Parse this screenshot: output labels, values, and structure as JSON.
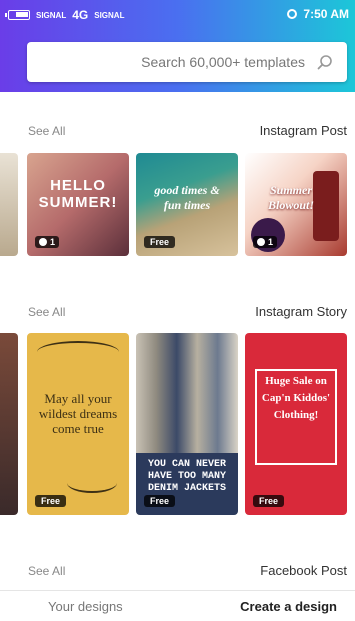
{
  "status_bar": {
    "time": "7:50 AM",
    "network": "4G",
    "signal_note": "SIGNAL"
  },
  "search": {
    "placeholder": "Search 60,000+ templates"
  },
  "sections": [
    {
      "title": "Instagram Post",
      "link": "See All",
      "cards": [
        {
          "badge": "1",
          "text": "Summer Blowout!",
          "badge_type": "coin"
        },
        {
          "badge": "Free",
          "text": "good times & fun times"
        },
        {
          "badge": "1",
          "text": "HELLO SUMMER!",
          "badge_type": "coin"
        }
      ]
    },
    {
      "title": "Instagram Story",
      "link": "See All",
      "cards": [
        {
          "badge": "Free",
          "text": "Huge Sale on Cap'n Kiddos' Clothing!"
        },
        {
          "badge": "Free",
          "text": "YOU CAN NEVER HAVE TOO MANY DENIM JACKETS"
        },
        {
          "badge": "Free",
          "text": "May all your wildest dreams come true"
        }
      ]
    },
    {
      "title": "Facebook Post",
      "link": "See All"
    }
  ],
  "tabs": {
    "create": "Create a design",
    "yours": "Your designs"
  },
  "colors": {
    "gradient_start": "#6a3de8",
    "gradient_end": "#1cc7d8",
    "accent": "#6a3de8"
  }
}
